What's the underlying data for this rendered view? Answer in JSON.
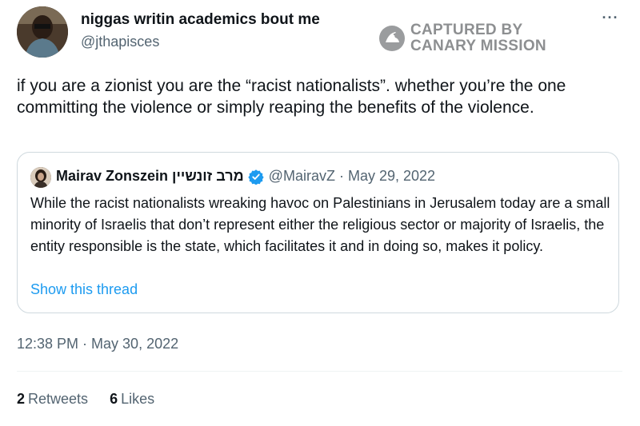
{
  "author": {
    "display_name": "niggas writin academics bout me",
    "handle": "@jthapisces"
  },
  "watermark": {
    "line1": "CAPTURED BY",
    "line2": "CANARY MISSION"
  },
  "more_label": "···",
  "tweet": {
    "text": "if you are a zionist you are the “racist nationalists”. whether you’re the one committing the violence or simply reaping the benefits of the violence."
  },
  "quoted": {
    "name": "Mairav Zonszein מרב זונשיין",
    "handle": "@MairavZ",
    "separator": "·",
    "date": "May 29, 2022",
    "text": "While the racist nationalists wreaking havoc on Palestinians in Jerusalem today are a small minority of Israelis that don’t represent either the religious sector or majority of Israelis, the entity responsible is the state, which facilitates it and in doing so, makes it policy.",
    "show_thread": "Show this thread"
  },
  "timestamp": "12:38 PM · May 30, 2022",
  "stats": {
    "retweets_count": "2",
    "retweets_label": "Retweets",
    "likes_count": "6",
    "likes_label": "Likes"
  },
  "colors": {
    "link": "#1d9bf0",
    "secondary_text": "#536471",
    "verified": "#1d9bf0",
    "watermark": "#8d8f91"
  }
}
